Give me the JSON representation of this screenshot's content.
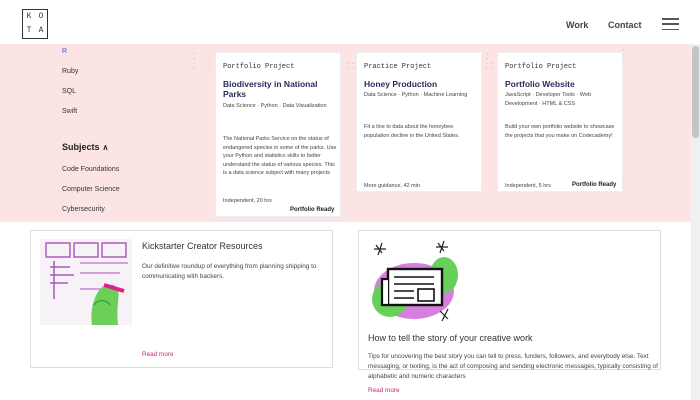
{
  "header": {
    "logo_letters": [
      "K",
      "O",
      "T",
      "A"
    ],
    "nav": {
      "work": "Work",
      "contact": "Contact"
    }
  },
  "languages": [
    "R",
    "Ruby",
    "SQL",
    "Swift"
  ],
  "subjects": {
    "heading": "Subjects",
    "items": [
      "Code Foundations",
      "Computer Science",
      "Cybersecurity"
    ]
  },
  "projects": [
    {
      "tag": "Portfolio Project",
      "title": "Biodiversity in National Parks",
      "meta": "Data Science · Python · Data Visualization",
      "description": "The National Parks Service on the status of endangered species in some of the parks. Use your Python and statistics skills to better understand the status of various species. This is a data science subject with many projects",
      "footer": "Independent, 20 hrs",
      "badge": "Portfolio Ready"
    },
    {
      "tag": "Practice Project",
      "title": "Honey Production",
      "meta": "Data Science · Python · Machine Learning",
      "description": "Fit a line to data about the honeybee population decline in the United States.",
      "footer": "More guidance, 42 min",
      "badge": ""
    },
    {
      "tag": "Portfolio Project",
      "title": "Portfolio Website",
      "meta": "JavaScript · Developer Tools · Web Development · HTML & CSS",
      "description": "Build your own portfolio website to showcase the projects that you make on Codecademy!",
      "footer": "Independent, 5 hrs",
      "badge": "Portfolio Ready"
    }
  ],
  "resources": [
    {
      "title": "Kickstarter Creator Resources",
      "description": "Our definitive roundup of everything from planning shipping to communicating with backers.",
      "read_more": "Read more",
      "image_icon": "whiteboard-drawing-illustration"
    },
    {
      "title": "How to tell the story of your creative work",
      "description": "Tips for uncovering the best story you can tell to press, funders, followers, and everybody else. Text messaging, or texting, is the act of composing and sending electronic messages, typically consisting of alphabetic and numeric characters",
      "read_more": "Read more",
      "image_icon": "newspaper-illustration"
    }
  ],
  "colors": {
    "pink_bg": "#fde4e4",
    "accent": "#c2287a",
    "title_navy": "#2b2b5a"
  }
}
